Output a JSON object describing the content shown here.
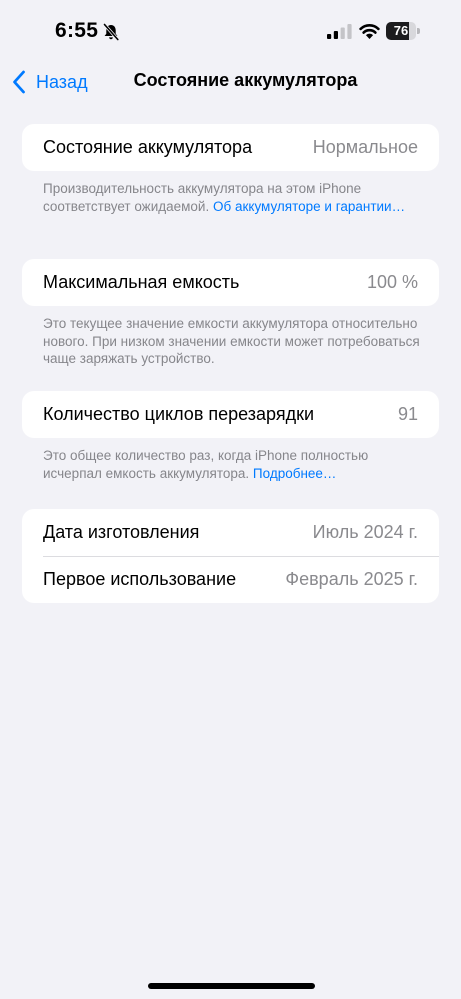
{
  "status_bar": {
    "time": "6:55",
    "battery_level": "76",
    "icons": [
      "bell-slash-icon",
      "cellular-signal-icon",
      "wifi-icon",
      "battery-icon"
    ]
  },
  "nav": {
    "back_label": "Назад",
    "title": "Состояние аккумулятора"
  },
  "sections": {
    "health": {
      "label": "Состояние аккумулятора",
      "value": "Нормальное",
      "footnote_text": "Производительность аккумулятора на этом iPhone соответствует ожидаемой. ",
      "footnote_link": "Об аккумуляторе и гарантии…"
    },
    "capacity": {
      "label": "Максимальная емкость",
      "value": "100 %",
      "footnote_text": "Это текущее значение емкости аккумулятора относительно нового. При низком значении емкости может потребоваться чаще заряжать устройство."
    },
    "cycles": {
      "label": "Количество циклов перезарядки",
      "value": "91",
      "footnote_text": "Это общее количество раз, когда iPhone полностью исчерпал емкость аккумулятора. ",
      "footnote_link": "Подробнее…"
    },
    "dates": {
      "manufacture_label": "Дата изготовления",
      "manufacture_value": "Июль 2024 г.",
      "first_use_label": "Первое использование",
      "first_use_value": "Февраль 2025 г."
    }
  },
  "colors": {
    "accent": "#007aff",
    "background": "#f2f2f7",
    "secondary_text": "#8a8a8e"
  }
}
